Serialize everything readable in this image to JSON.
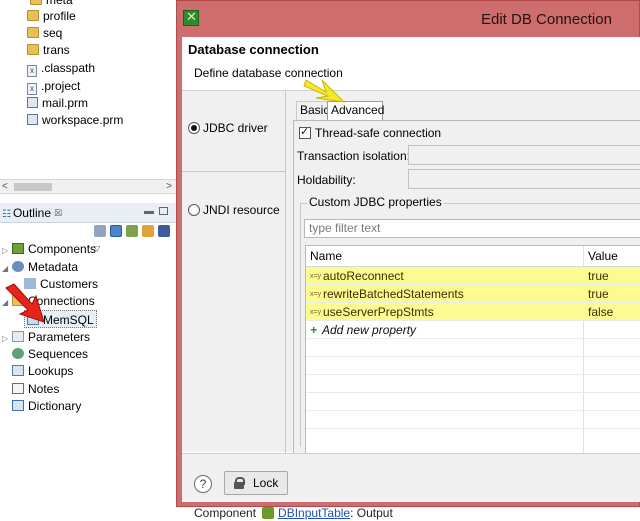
{
  "repo_tree": {
    "items": [
      {
        "label": "meta",
        "icon": "folder-icon"
      },
      {
        "label": "profile",
        "icon": "folder-icon"
      },
      {
        "label": "seq",
        "icon": "folder-icon"
      },
      {
        "label": "trans",
        "icon": "folder-icon"
      },
      {
        "label": ".classpath",
        "icon": "xml-file-icon"
      },
      {
        "label": ".project",
        "icon": "xml-file-icon"
      },
      {
        "label": "mail.prm",
        "icon": "prm-file-icon"
      },
      {
        "label": "workspace.prm",
        "icon": "prm-file-icon"
      }
    ]
  },
  "outline": {
    "tab_label": "Outline",
    "close_glyph": "☒",
    "items": [
      {
        "label": "Components",
        "expand": "▷"
      },
      {
        "label": "Metadata",
        "expand": "◢"
      },
      {
        "label": "Customers",
        "expand": ""
      },
      {
        "label": "Connections",
        "expand": "◢"
      },
      {
        "label": "MemSQL",
        "expand": ""
      },
      {
        "label": "Parameters",
        "expand": "▷"
      },
      {
        "label": "Sequences",
        "expand": ""
      },
      {
        "label": "Lookups",
        "expand": ""
      },
      {
        "label": "Notes",
        "expand": ""
      },
      {
        "label": "Dictionary",
        "expand": ""
      }
    ]
  },
  "status": {
    "label": "Component",
    "link": "DBInputTable",
    "suffix": ": Output"
  },
  "dialog": {
    "title": "Edit DB Connection",
    "heading": "Database connection",
    "subheading": "Define database connection",
    "driver_options": [
      {
        "label": "JDBC driver",
        "selected": true
      },
      {
        "label": "JNDI resource",
        "selected": false
      }
    ],
    "tabs": [
      {
        "label": "Basic",
        "active": false
      },
      {
        "label": "Advanced",
        "active": true
      }
    ],
    "thread_safe": {
      "label": "Thread-safe connection",
      "checked": true
    },
    "transaction_isolation_label": "Transaction isolation:",
    "holdability_label": "Holdability:",
    "custom_props_label": "Custom JDBC properties",
    "filter_placeholder": "type filter text",
    "columns": {
      "name": "Name",
      "value": "Value"
    },
    "properties": [
      {
        "name": "autoReconnect",
        "value": "true"
      },
      {
        "name": "rewriteBatchedStatements",
        "value": "true"
      },
      {
        "name": "useServerPrepStmts",
        "value": "false"
      }
    ],
    "add_property_label": "Add new property",
    "help_glyph": "?",
    "lock_label": "Lock"
  },
  "colors": {
    "titlebar": "#cd6d6d",
    "highlight": "#fbfb92",
    "red_arrow": "#e8231b",
    "yellow_arrow": "#f3e82a"
  }
}
